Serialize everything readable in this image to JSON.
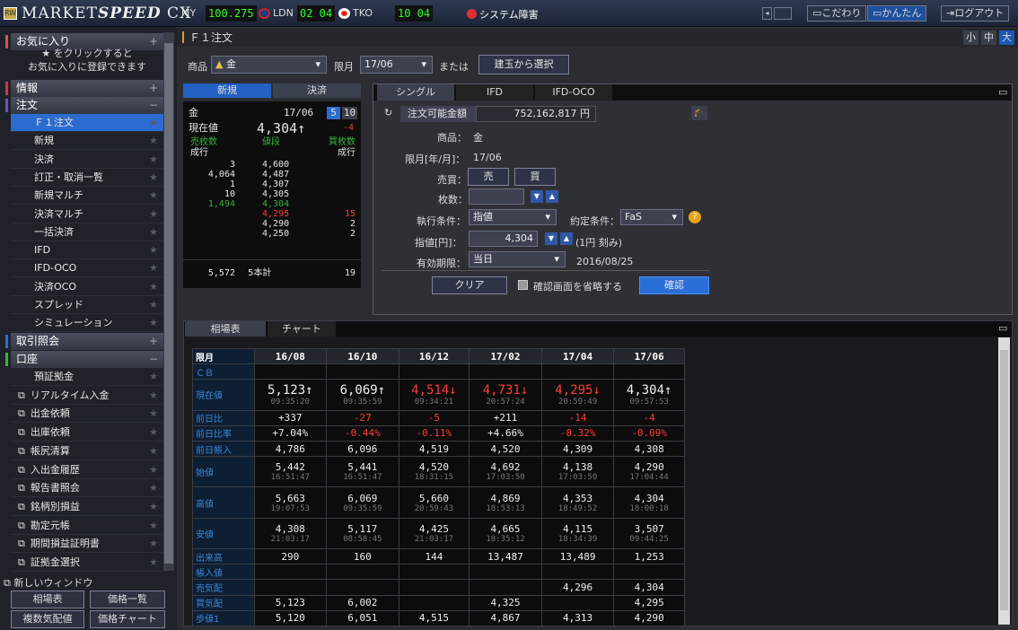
{
  "topbar": {
    "brand_a": "MARKET",
    "brand_b": "SPEED",
    "brand_c": " CX",
    "logo": "RW",
    "tickers": [
      {
        "label": "MY",
        "value": "100.275"
      },
      {
        "label": "LDN",
        "value": "02 04"
      },
      {
        "label": "TKO",
        "value": "10 04"
      }
    ],
    "system_alert": "システム障害",
    "buttons": [
      "こだわり",
      "かんたん",
      "ログアウト"
    ]
  },
  "sidebar": {
    "favorites": {
      "label": "お気に入り",
      "hint_line1": "★ をクリックすると",
      "hint_line2": "お気に入りに登録できます"
    },
    "info": "情報",
    "order": "注文",
    "order_items": [
      "Ｆ１注文",
      "新規",
      "決済",
      "訂正・取消一覧",
      "新規マルチ",
      "決済マルチ",
      "一括決済",
      "IFD",
      "IFD-OCO",
      "決済OCO",
      "スプレッド",
      "シミュレーション"
    ],
    "trade": "取引照会",
    "account": "口座",
    "account_items": [
      "預証拠金",
      "リアルタイム入金",
      "出金依頼",
      "出庫依頼",
      "帳尻清算",
      "入出金履歴",
      "報告書照会",
      "銘柄別損益",
      "勘定元帳",
      "期間損益証明書",
      "証拠金選択"
    ],
    "new_window": "新しいウィンドウ",
    "bottom_buttons": [
      "相場表",
      "価格一覧",
      "複数気配値",
      "価格チャート"
    ]
  },
  "main": {
    "title": "Ｆ１注文",
    "size_buttons": [
      "小",
      "中",
      "大"
    ],
    "product_label": "商品",
    "product_value": "金",
    "month_label": "限月",
    "month_value": "17/06",
    "or_label": "または",
    "position_button": "建玉から選択",
    "board_tabs": [
      "新規",
      "決済"
    ],
    "order_tabs": [
      "シングル",
      "IFD",
      "IFD-OCO"
    ],
    "board": {
      "name": "金",
      "month": "17/06",
      "btn5": "5",
      "btn10": "10",
      "price_label": "現在値",
      "price": "4,304↑",
      "change": "-4",
      "sell_label": "売枚数",
      "price_col": "値段",
      "buy_label": "買枚数",
      "market_sell": "成行",
      "market_buy": "成行",
      "rows": [
        {
          "sell": "3",
          "price": "4,600",
          "buy": ""
        },
        {
          "sell": "4,064",
          "price": "4,487",
          "buy": ""
        },
        {
          "sell": "1",
          "price": "4,307",
          "buy": ""
        },
        {
          "sell": "10",
          "price": "4,305",
          "buy": ""
        },
        {
          "sell": "1,494",
          "price": "4,304",
          "buy": ""
        },
        {
          "sell": "",
          "price": "4,295",
          "buy": "15"
        },
        {
          "sell": "",
          "price": "4,290",
          "buy": "2"
        },
        {
          "sell": "",
          "price": "4,250",
          "buy": "2"
        }
      ],
      "total_sell": "5,572",
      "total_label": "5本計",
      "total_buy": "19"
    },
    "form": {
      "available_label": "注文可能金額",
      "available_value": "752,162,817 円",
      "product_label": "商品：",
      "product_value": "金",
      "month_label": "限月[年/月]：",
      "month_value": "17/06",
      "side_label": "売買：",
      "sell": "売",
      "buy": "買",
      "qty_label": "枚数：",
      "exec_label": "執行条件：",
      "exec_value": "指値",
      "cond_label": "約定条件：",
      "cond_value": "FaS",
      "price_label": "指値[円]：",
      "price_value": "4,304",
      "tick": "(1円 刻み)",
      "expiry_label": "有効期限：",
      "expiry_value": "当日",
      "expiry_date": "2016/08/25",
      "clear": "クリア",
      "skip_confirm": "確認画面を省略する",
      "confirm": "確認"
    },
    "market_tabs": [
      "相場表",
      "チャート"
    ],
    "market": {
      "months": [
        "16/08",
        "16/10",
        "16/12",
        "17/02",
        "17/04",
        "17/06"
      ],
      "rows": [
        {
          "label": "限月",
          "header": true
        },
        {
          "label": "ＣＢ",
          "values": [
            "",
            "",
            "",
            "",
            "",
            ""
          ]
        },
        {
          "label": "現在値",
          "big": true,
          "values": [
            "5,123↑",
            "6,069↑",
            "4,514↓",
            "4,731↓",
            "4,295↓",
            "4,304↑"
          ],
          "dir": [
            "up",
            "up",
            "dn",
            "dn",
            "dn",
            "up"
          ],
          "sub": [
            "09:35:20",
            "09:35:59",
            "09:34:21",
            "20:57:24",
            "20:59:49",
            "09:57:53"
          ]
        },
        {
          "label": "前日比",
          "values": [
            "+337",
            "-27",
            "-5",
            "+211",
            "-14",
            "-4"
          ],
          "dir": [
            "up",
            "dn",
            "dn",
            "up",
            "dn",
            "dn"
          ]
        },
        {
          "label": "前日比率",
          "values": [
            "+7.04%",
            "-0.44%",
            "-0.11%",
            "+4.66%",
            "-0.32%",
            "-0.09%"
          ],
          "dir": [
            "up",
            "dn",
            "dn",
            "up",
            "dn",
            "dn"
          ]
        },
        {
          "label": "前日帳入",
          "values": [
            "4,786",
            "6,096",
            "4,519",
            "4,520",
            "4,309",
            "4,308"
          ]
        },
        {
          "label": "始値",
          "values": [
            "5,442",
            "5,441",
            "4,520",
            "4,692",
            "4,138",
            "4,290"
          ],
          "sub": [
            "16:51:47",
            "16:51:47",
            "18:31:15",
            "17:03:50",
            "17:03:50",
            "17:04:44"
          ]
        },
        {
          "label": "高値",
          "values": [
            "5,663",
            "6,069",
            "5,660",
            "4,869",
            "4,353",
            "4,304"
          ],
          "sub": [
            "19:07:53",
            "09:35:59",
            "20:59:43",
            "18:53:13",
            "18:49:52",
            "18:00:18"
          ]
        },
        {
          "label": "安値",
          "values": [
            "4,308",
            "5,117",
            "4,425",
            "4,665",
            "4,115",
            "3,507"
          ],
          "sub": [
            "21:03:17",
            "08:58:45",
            "21:03:17",
            "18:35:12",
            "18:34:39",
            "09:44:25"
          ]
        },
        {
          "label": "出来高",
          "values": [
            "290",
            "160",
            "144",
            "13,487",
            "13,489",
            "1,253"
          ]
        },
        {
          "label": "帳入値",
          "values": [
            "",
            "",
            "",
            "",
            "",
            ""
          ]
        },
        {
          "label": "売気配",
          "values": [
            "",
            "",
            "",
            "",
            "4,296",
            "4,304"
          ]
        },
        {
          "label": "買気配",
          "values": [
            "5,123",
            "6,002",
            "",
            "4,325",
            "",
            "4,295"
          ]
        },
        {
          "label": "歩値1",
          "values": [
            "5,120",
            "6,051",
            "4,515",
            "4,867",
            "4,313",
            "4,290"
          ]
        }
      ]
    }
  },
  "colors": {
    "accent": "#2c6bd0",
    "down": "#ff3b3b",
    "ticker_green": "#2bff2b",
    "label_blue": "#3b87d8"
  }
}
